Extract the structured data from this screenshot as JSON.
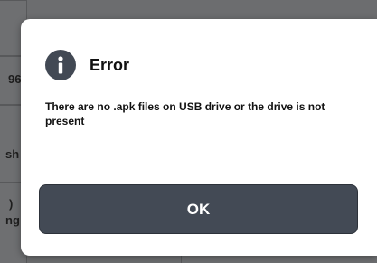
{
  "background": {
    "fragments": [
      "96",
      "sh",
      ")",
      "ng"
    ]
  },
  "dialog": {
    "icon": "info-icon",
    "title": "Error",
    "message": "There are no .apk files on USB drive or the drive is not present",
    "ok_label": "OK"
  },
  "colors": {
    "overlay": "#6c6d6f",
    "dialog_bg": "#ffffff",
    "icon_bg": "#424954",
    "button_bg": "#434a55",
    "button_text": "#ffffff"
  }
}
